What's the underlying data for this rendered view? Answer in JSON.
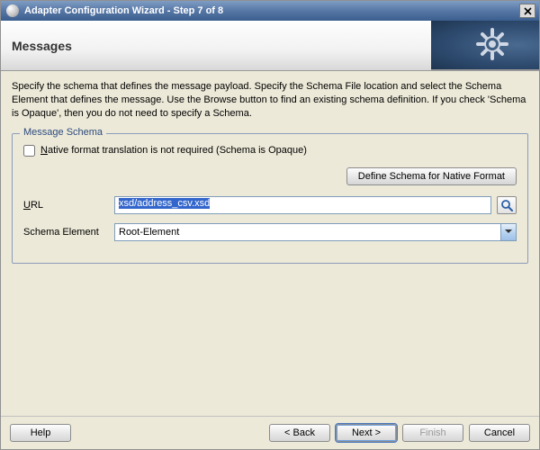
{
  "title": "Adapter Configuration Wizard - Step 7 of 8",
  "header": {
    "title": "Messages"
  },
  "description": "Specify the schema that defines the message payload.  Specify the Schema File location and select the Schema Element that defines the message. Use the Browse button to find an existing schema definition. If you check 'Schema is Opaque', then you do not need to specify a Schema.",
  "fieldset": {
    "legend": "Message Schema",
    "opaque_label_pre": "N",
    "opaque_label_post": "ative format translation is not required (Schema is Opaque)",
    "define_button": "Define Schema for Native Format",
    "url_label_pre": "U",
    "url_label_post": "RL",
    "url_value": "xsd/address_csv.xsd",
    "schema_element_label": "Schema Element",
    "schema_element_value": "Root-Element"
  },
  "footer": {
    "help": "Help",
    "back": "< Back",
    "next": "Next >",
    "finish": "Finish",
    "cancel": "Cancel"
  }
}
